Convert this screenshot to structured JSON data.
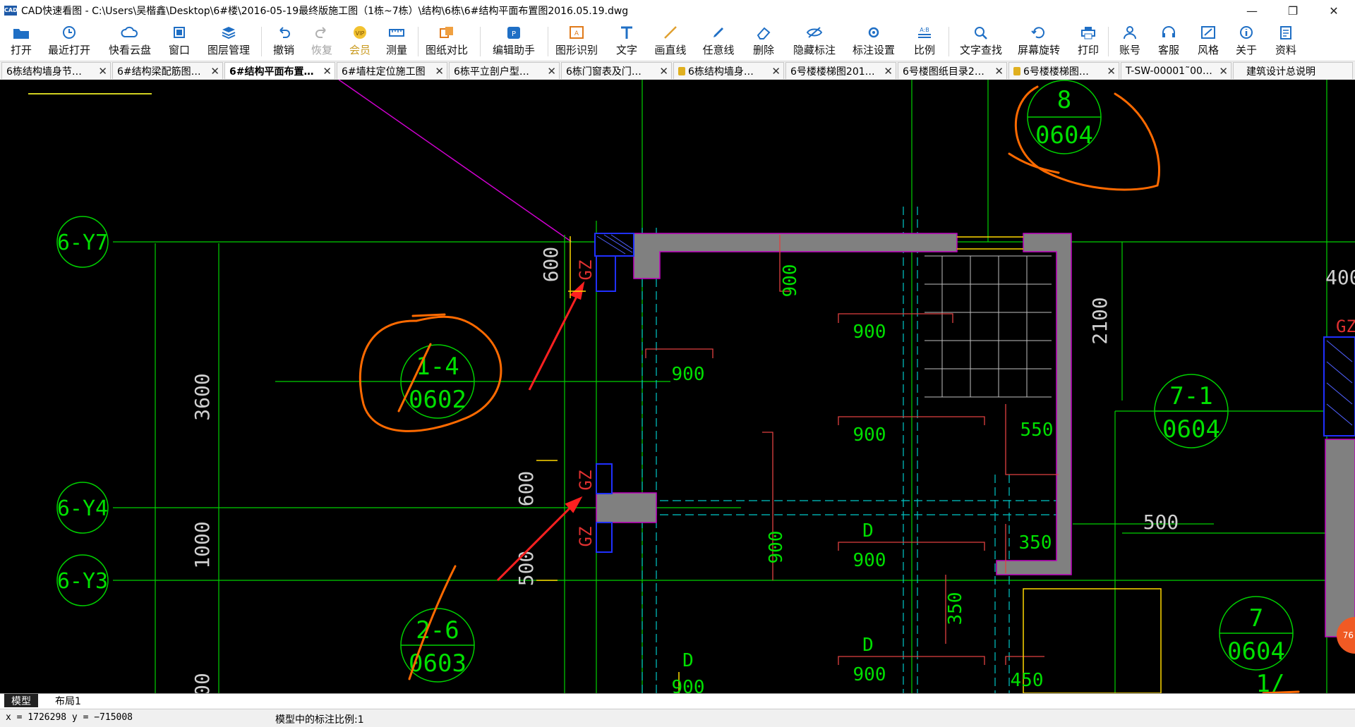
{
  "window": {
    "icon_label": "CAD",
    "title": "CAD快速看图 - C:\\Users\\吴楷鑫\\Desktop\\6#楼\\2016-05-19最终版施工图（1栋~7栋）\\结构\\6栋\\6#结构平面布置图2016.05.19.dwg",
    "minimize": "—",
    "restore": "❐",
    "close": "✕"
  },
  "toolbar": [
    {
      "label": "打开",
      "icon": "folder-open-icon"
    },
    {
      "label": "最近打开",
      "icon": "clock-icon"
    },
    {
      "label": "快看云盘",
      "icon": "cloud-icon"
    },
    {
      "label": "窗口",
      "icon": "window-icon"
    },
    {
      "label": "图层管理",
      "icon": "layers-icon"
    },
    {
      "label": "撤销",
      "icon": "undo-icon"
    },
    {
      "label": "恢复",
      "icon": "redo-icon"
    },
    {
      "label": "会员",
      "icon": "vip-icon"
    },
    {
      "label": "测量",
      "icon": "ruler-icon"
    },
    {
      "label": "图纸对比",
      "icon": "compare-icon"
    },
    {
      "label": "编辑助手",
      "icon": "edit-assistant-icon"
    },
    {
      "label": "图形识别",
      "icon": "shape-recognize-icon"
    },
    {
      "label": "文字",
      "icon": "text-icon"
    },
    {
      "label": "画直线",
      "icon": "line-icon"
    },
    {
      "label": "任意线",
      "icon": "pen-icon"
    },
    {
      "label": "删除",
      "icon": "eraser-icon"
    },
    {
      "label": "隐藏标注",
      "icon": "eye-hide-icon"
    },
    {
      "label": "标注设置",
      "icon": "dimension-settings-icon"
    },
    {
      "label": "比例",
      "icon": "scale-icon"
    },
    {
      "label": "文字查找",
      "icon": "text-search-icon"
    },
    {
      "label": "屏幕旋转",
      "icon": "rotate-icon"
    },
    {
      "label": "打印",
      "icon": "printer-icon"
    },
    {
      "label": "账号",
      "icon": "user-icon"
    },
    {
      "label": "客服",
      "icon": "headset-icon"
    },
    {
      "label": "风格",
      "icon": "style-icon"
    },
    {
      "label": "关于",
      "icon": "info-icon"
    },
    {
      "label": "资料",
      "icon": "document-icon"
    }
  ],
  "tabs": [
    {
      "label": "6栋结构墙身节…",
      "close": "✕"
    },
    {
      "label": "6#结构梁配筋图…",
      "close": "✕"
    },
    {
      "label": "6#结构平面布置…",
      "close": "✕"
    },
    {
      "label": "6#墙柱定位施工图",
      "close": "✕"
    },
    {
      "label": "6栋平立剖户型…",
      "close": "✕"
    },
    {
      "label": "6栋门窗表及门…",
      "close": "✕"
    },
    {
      "label": "6栋结构墙身…",
      "close": "✕"
    },
    {
      "label": "6号楼楼梯图201…",
      "close": "✕"
    },
    {
      "label": "6号楼图纸目录2…",
      "close": "✕"
    },
    {
      "label": "6号楼楼梯图…",
      "close": "✕"
    },
    {
      "label": "T-SW-00001˜00…",
      "close": "✕"
    },
    {
      "label": "建筑设计总说明",
      "close": ""
    }
  ],
  "drawing": {
    "axes": [
      "6-Y7",
      "6-Y4",
      "6-Y3"
    ],
    "dims_left": [
      "3600",
      "1000",
      "00"
    ],
    "dims_mid": [
      "600",
      "600",
      "500"
    ],
    "dims_right": [
      "2100",
      "500",
      "400"
    ],
    "gz": "GZ",
    "room_dims": [
      "900",
      "900",
      "900",
      "900",
      "900",
      "900",
      "900",
      "550",
      "350",
      "350",
      "450",
      "900"
    ],
    "d_label": "D",
    "sections": [
      {
        "top": "1-4",
        "bottom": "0602"
      },
      {
        "top": "2-6",
        "bottom": "0603"
      },
      {
        "top": "8",
        "bottom": "0604"
      },
      {
        "top": "7-1",
        "bottom": "0604"
      },
      {
        "top": "7",
        "bottom": "0604"
      },
      {
        "top": "1/",
        "bottom": ""
      }
    ],
    "badge": "76"
  },
  "layout_tabs": {
    "model": "模型",
    "layout1": "布局1"
  },
  "status": {
    "coords": "x = 1726298  y = −715008",
    "scale": "模型中的标注比例:1"
  },
  "colors": {
    "accent": "#1f6fc5",
    "canvas": "#000000",
    "green": "#00e000",
    "cyan": "#00e0e0",
    "magenta": "#e000e0",
    "red": "#ff3030",
    "orange": "#ff6a00",
    "wall": "#808080"
  }
}
